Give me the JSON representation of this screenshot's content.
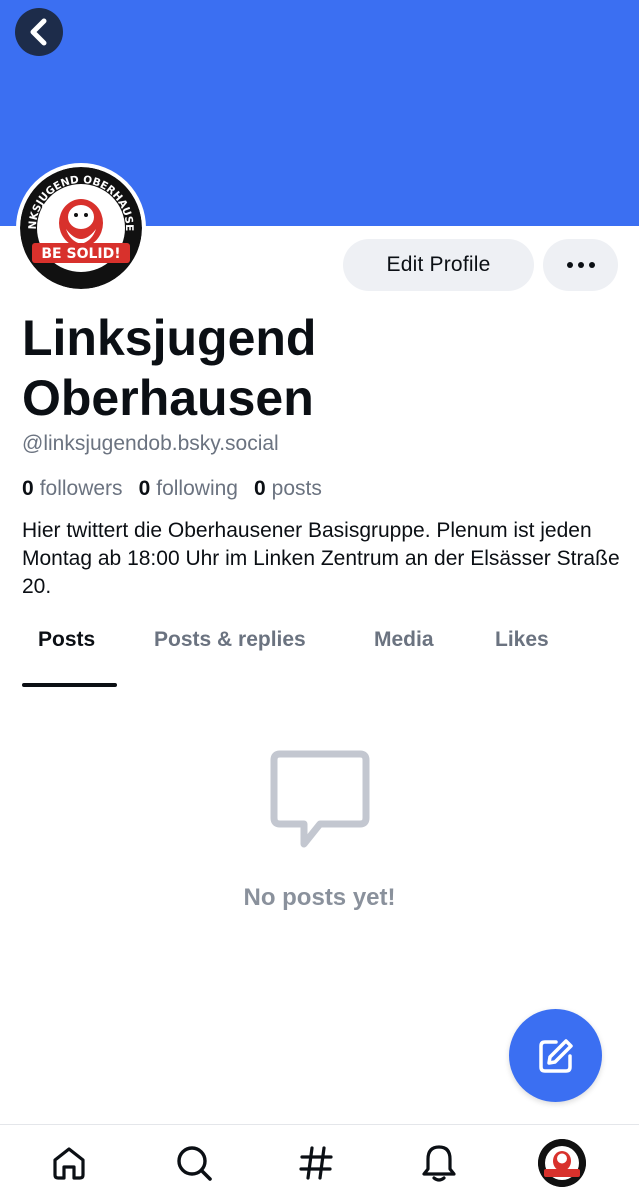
{
  "profile": {
    "display_name": "Linksjugend Oberhausen",
    "handle": "@linksjugendob.bsky.social",
    "followers_count": "0",
    "followers_label": "followers",
    "following_count": "0",
    "following_label": "following",
    "posts_count": "0",
    "posts_label": "posts",
    "bio": "Hier twittert die Oberhausener Basisgruppe. Plenum ist jeden Montag ab 18:00 Uhr im Linken Zentrum an der Elsässer Straße 20.",
    "avatar_text_top": "LINKSJUGEND OBERHAUSEN",
    "avatar_text_bottom": "BE SOLID!"
  },
  "actions": {
    "edit_profile_label": "Edit Profile",
    "more_icon": "more-horizontal-icon",
    "back_icon": "chevron-left-icon"
  },
  "tabs": [
    {
      "label": "Posts",
      "active": true
    },
    {
      "label": "Posts & replies",
      "active": false
    },
    {
      "label": "Media",
      "active": false
    },
    {
      "label": "Likes",
      "active": false
    }
  ],
  "empty_state": {
    "icon": "message-square-icon",
    "text": "No posts yet!"
  },
  "compose": {
    "icon": "compose-icon"
  },
  "bottom_nav": [
    {
      "icon": "home-icon"
    },
    {
      "icon": "search-icon"
    },
    {
      "icon": "hashtag-icon"
    },
    {
      "icon": "bell-icon"
    },
    {
      "icon": "profile-avatar-icon"
    }
  ],
  "colors": {
    "banner": "#3b6ff2",
    "accent": "#3b6ff2",
    "text_primary": "#0b0f14",
    "text_secondary": "#6b7380",
    "button_bg": "#eef0f4"
  }
}
